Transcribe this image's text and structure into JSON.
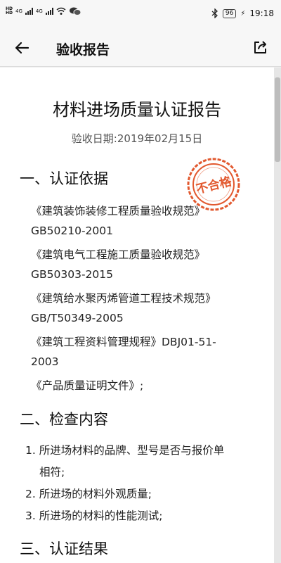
{
  "status_bar": {
    "sim1": "HD",
    "sim2": "HD",
    "net1": "4G",
    "net2": "4G",
    "battery": "96",
    "time": "19:18"
  },
  "app_bar": {
    "title": "验收报告"
  },
  "document": {
    "title": "材料进场质量认证报告",
    "date": "验收日期:2019年02月15日",
    "stamp_text": "不合格",
    "sections": [
      {
        "heading": "一、认证依据",
        "lines": [
          "《建筑装饰装修工程质量验收规范》",
          "GB50210-2001",
          "《建筑电气工程施工质量验收规范》",
          "GB50303-2015",
          "《建筑给水聚丙烯管道工程技术规范》",
          "GB/T50349-2005",
          "《建筑工程资料管理规程》DBJ01-51-",
          "2003",
          "《产品质量证明文件》;"
        ]
      },
      {
        "heading": "二、检查内容",
        "lines": [
          "1. 所进场材料的品牌、型号是否与报价单",
          "相符;",
          "2. 所进场的材料外观质量;",
          "3. 所进场的材料的性能测试;"
        ]
      },
      {
        "heading": "三、认证结果",
        "lines": []
      }
    ]
  }
}
